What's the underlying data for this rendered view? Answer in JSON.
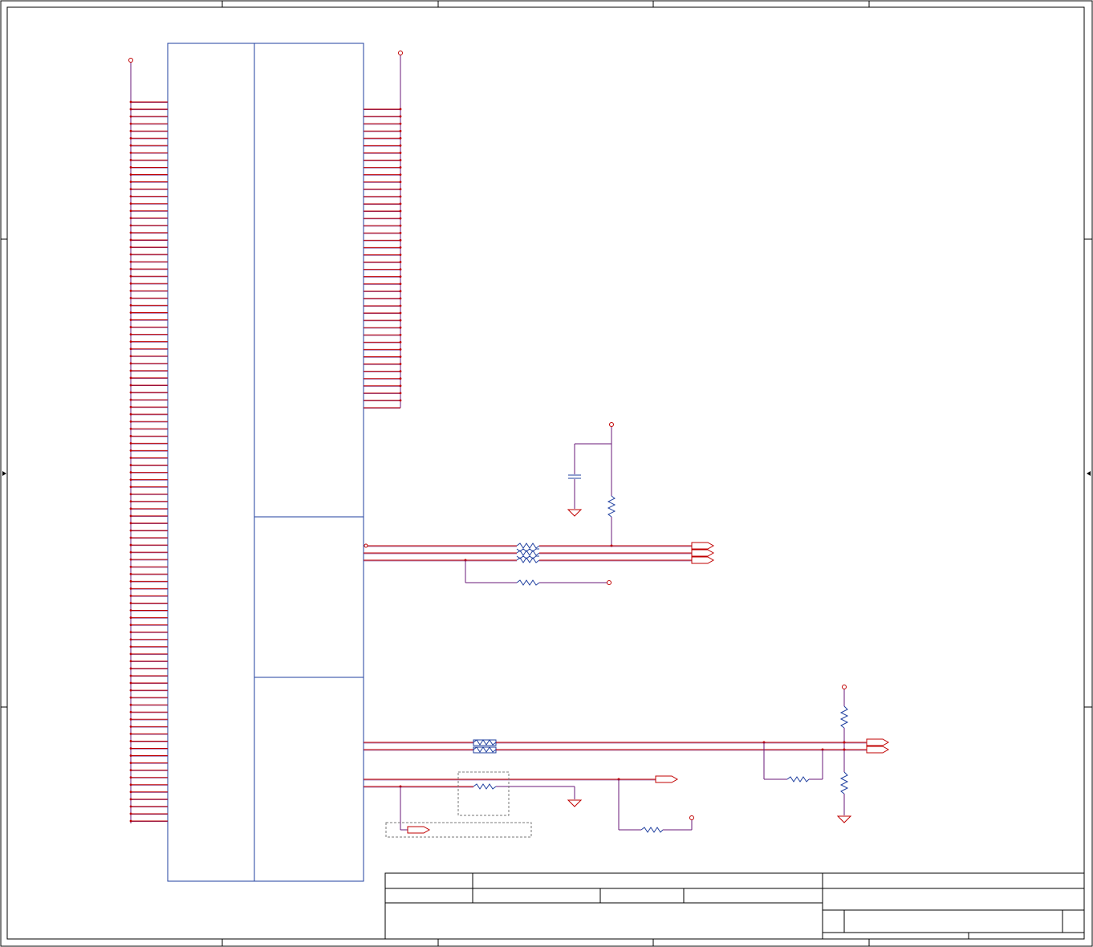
{
  "sheet": {
    "title": "",
    "grid_columns": 5,
    "grid_rows": 4
  },
  "colors": {
    "border": "#000000",
    "component": "#1f3f9f",
    "wire": "#c00000",
    "net": "#6a1a7a",
    "dashed_box": "#7a7a7a"
  },
  "connector": {
    "left_pin_count": 100,
    "right_pin_count": 42
  },
  "title_block": {
    "rows": 3
  }
}
